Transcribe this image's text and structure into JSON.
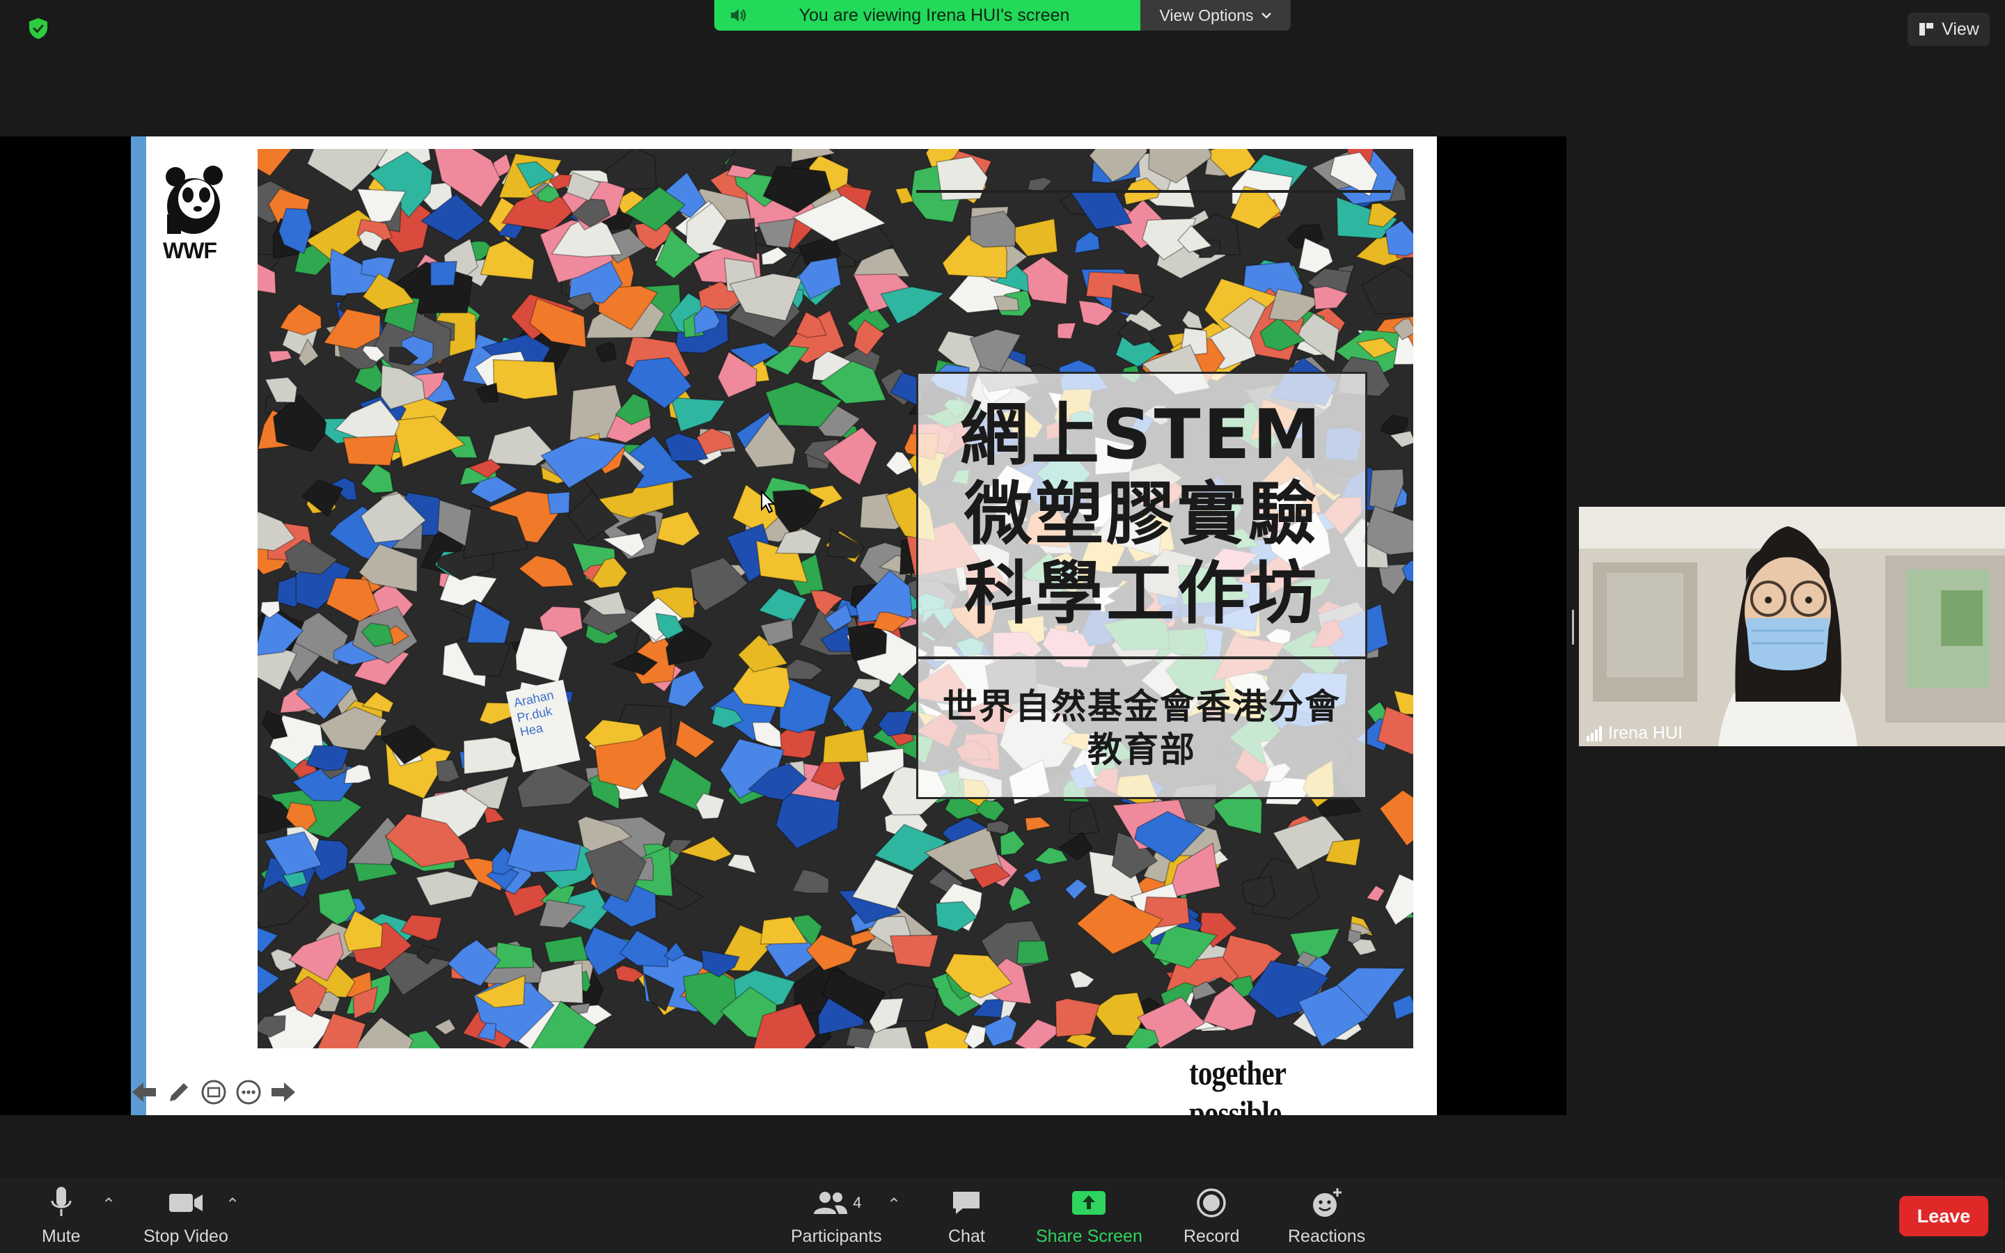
{
  "banner": {
    "viewing_text": "You are viewing Irena HUI's screen",
    "view_options_label": "View Options"
  },
  "view_button": {
    "label": "View"
  },
  "slide": {
    "logo_text": "WWF",
    "title_lines": [
      "網上STEM",
      "微塑膠實驗",
      "科學工作坊"
    ],
    "subtitle_lines": [
      "世界自然基金會香港分會",
      "教育部"
    ],
    "tagline": "together possible",
    "tagline_mark": "™",
    "photo_label_lines": [
      "Arahan",
      "Pr.duk",
      "Hea"
    ]
  },
  "participant": {
    "name": "Irena HUI"
  },
  "toolbar": {
    "mute": "Mute",
    "stop_video": "Stop Video",
    "participants": "Participants",
    "participants_count": "4",
    "chat": "Chat",
    "share_screen": "Share Screen",
    "record": "Record",
    "reactions": "Reactions",
    "leave": "Leave"
  },
  "colors": {
    "banner_green": "#23d959",
    "share_green": "#2fd45f",
    "leave_red": "#e02828",
    "slide_accent_blue": "#5a9bd5"
  },
  "icons": [
    "shield-check-icon",
    "speaker-icon",
    "chevron-down-icon",
    "view-layout-icon",
    "microphone-icon",
    "video-camera-icon",
    "participants-icon",
    "chat-icon",
    "share-screen-icon",
    "record-icon",
    "reactions-icon",
    "signal-icon",
    "panda-logo-icon"
  ]
}
